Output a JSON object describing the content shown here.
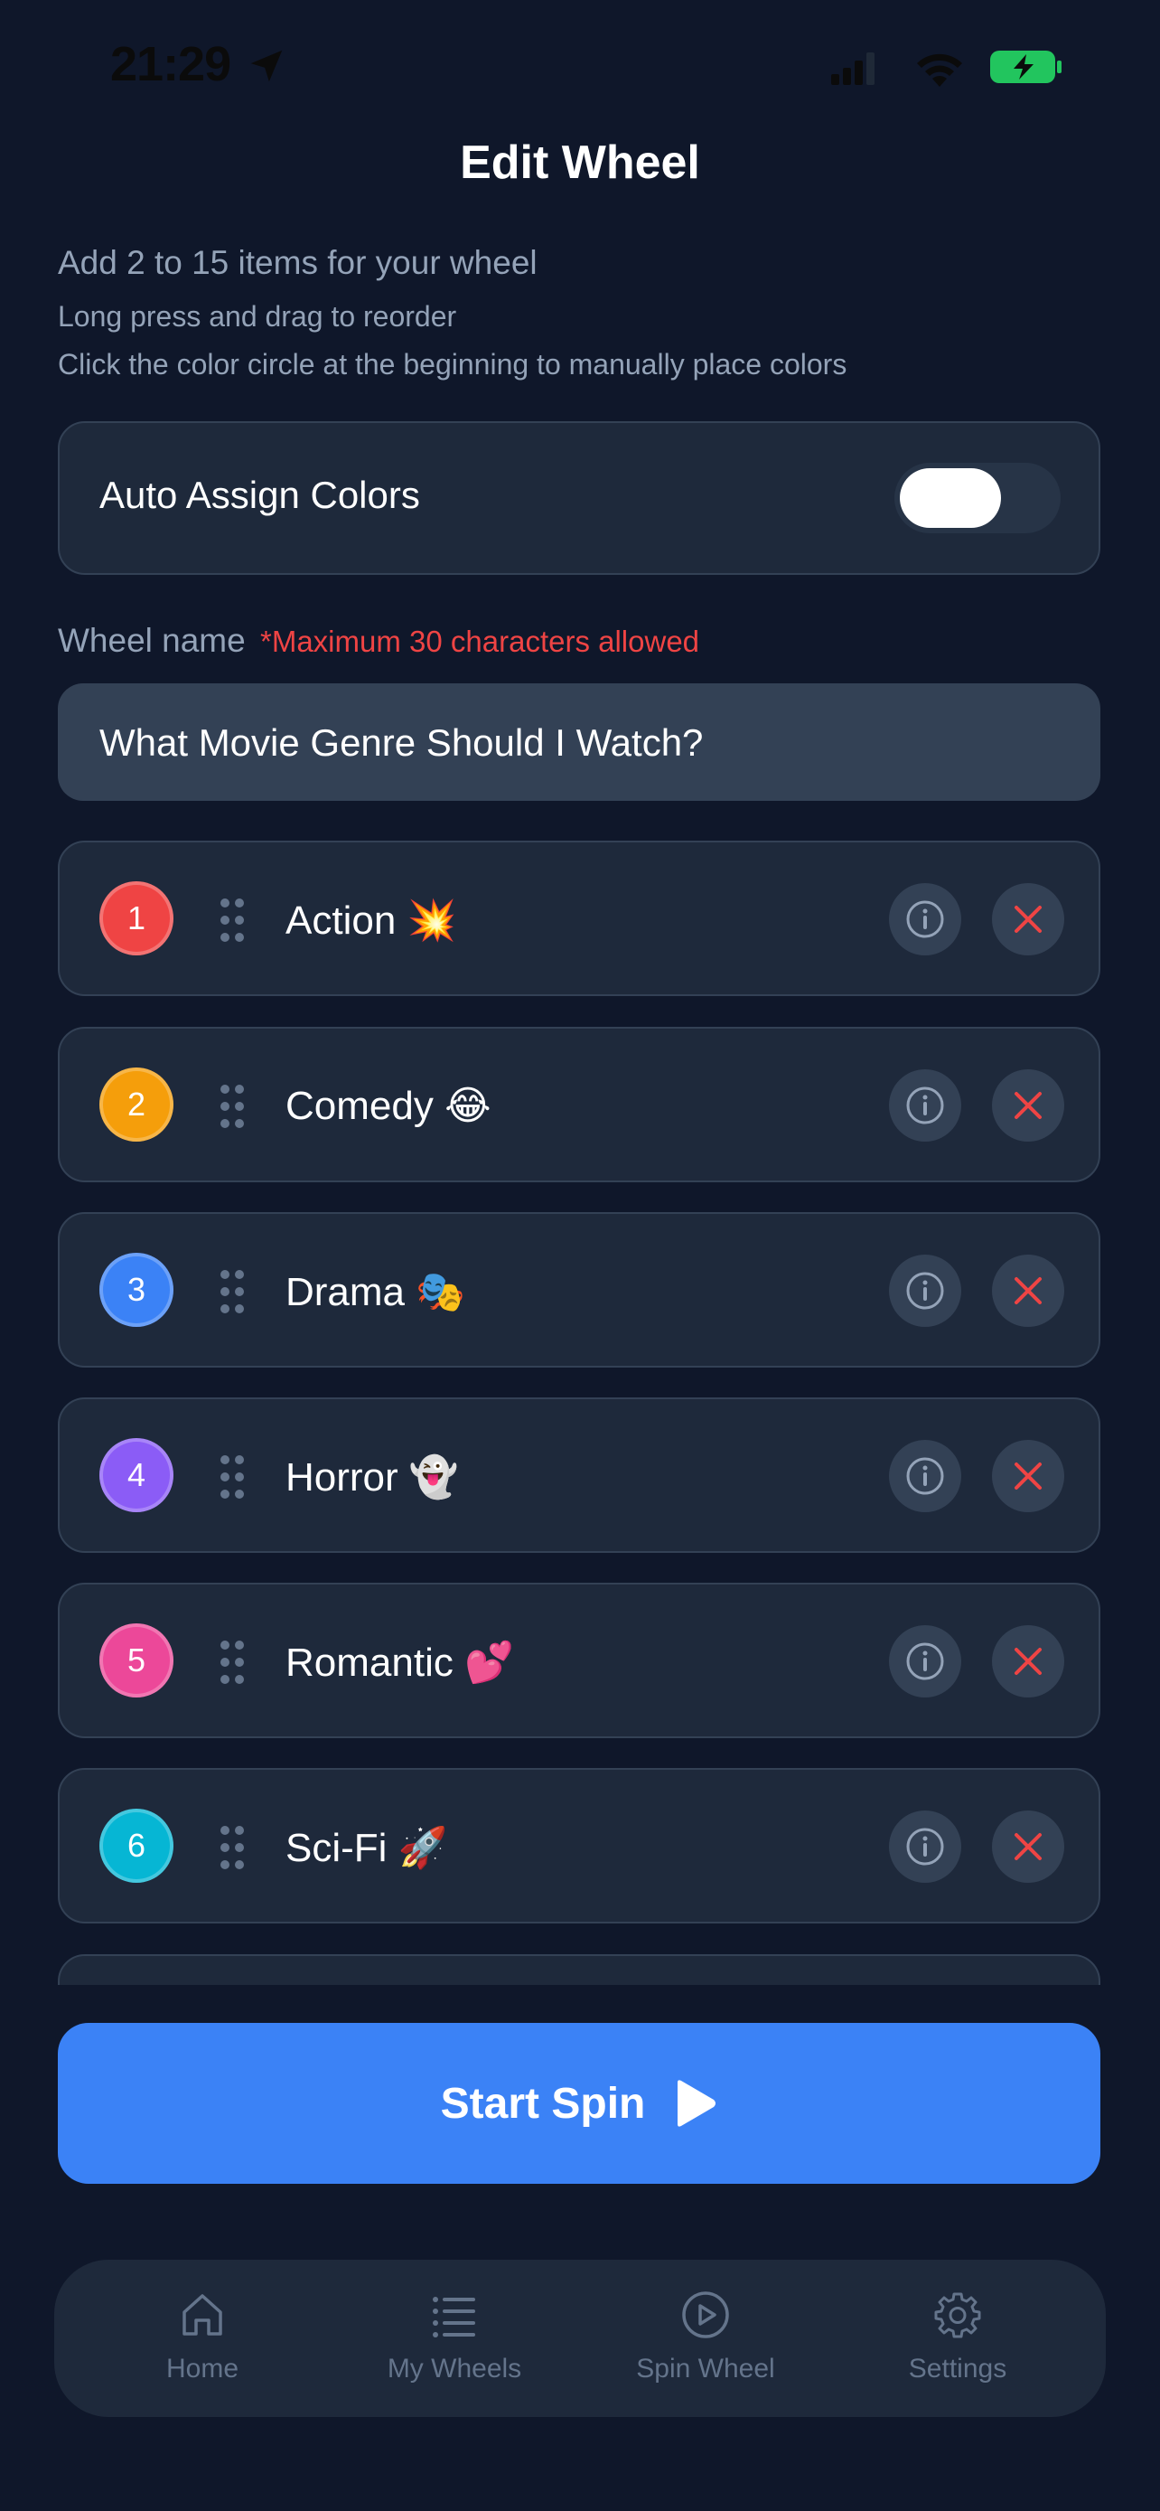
{
  "status_bar": {
    "time": "21:29"
  },
  "header": {
    "title": "Edit Wheel"
  },
  "instructions": {
    "line1": "Add 2 to 15 items for your wheel",
    "line2": "Long press and drag to reorder",
    "line3": "Click the color circle at the beginning to manually place colors"
  },
  "auto_assign": {
    "label": "Auto Assign Colors",
    "enabled": true
  },
  "wheel_name": {
    "label": "Wheel name",
    "requirement": "*Maximum 30 characters allowed",
    "value": "What Movie Genre Should I Watch?"
  },
  "items": [
    {
      "number": "1",
      "label": "Action 💥",
      "color": "#ef4444"
    },
    {
      "number": "2",
      "label": "Comedy 😂",
      "color": "#f59e0b"
    },
    {
      "number": "3",
      "label": "Drama 🎭",
      "color": "#3b82f6"
    },
    {
      "number": "4",
      "label": "Horror 👻",
      "color": "#8b5cf6"
    },
    {
      "number": "5",
      "label": "Romantic 💕",
      "color": "#ec4899"
    },
    {
      "number": "6",
      "label": "Sci-Fi 🚀",
      "color": "#06b6d4"
    }
  ],
  "actions": {
    "start_spin": "Start Spin"
  },
  "tabbar": {
    "home": "Home",
    "my_wheels": "My Wheels",
    "spin_wheel": "Spin Wheel",
    "settings": "Settings"
  },
  "colors": {
    "background": "#0f172a",
    "card": "#1e293b",
    "accent": "#3b82f6",
    "danger": "#ef4444",
    "muted": "#94a3b8"
  }
}
